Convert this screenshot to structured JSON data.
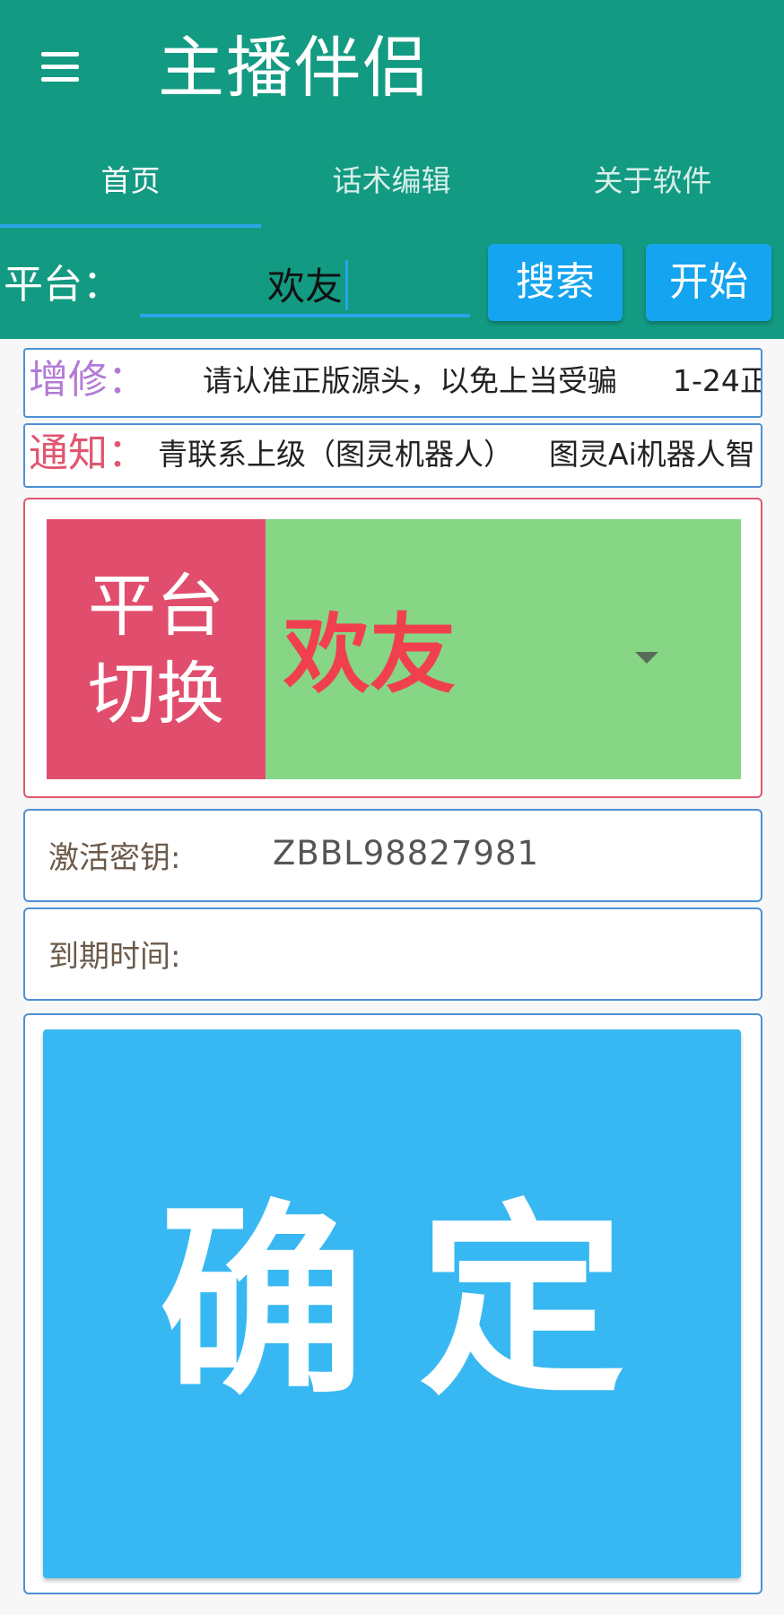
{
  "app": {
    "title": "主播伴侣"
  },
  "tabs": [
    {
      "label": "首页",
      "active": true
    },
    {
      "label": "话术编辑",
      "active": false
    },
    {
      "label": "关于软件",
      "active": false
    }
  ],
  "search": {
    "label": "平台：",
    "value": "欢友",
    "search_button": "搜索",
    "start_button": "开始"
  },
  "notices": {
    "update_label": "增修：",
    "update_text": "请认准正版源头，以免上当受骗",
    "update_text_2": "1-24正",
    "notify_label": "通知：",
    "notify_text": "青联系上级（图灵机器人）",
    "notify_text_2": "图灵Ai机器人智"
  },
  "platform_switch": {
    "label": "平台切换",
    "selected": "欢友"
  },
  "activation": {
    "key_label": "激活密钥:",
    "key_value": "ZBBL98827981",
    "expire_label": "到期时间:",
    "expire_value": ""
  },
  "confirm": {
    "label": "确定"
  },
  "colors": {
    "header": "#139a82",
    "accent_blue": "#15a4ef",
    "confirm_blue": "#38b8f2",
    "switch_red": "#e14e6d",
    "switch_green": "#87d686",
    "update_label_color": "#b37bd6",
    "notify_label_color": "#e0566f"
  },
  "icons": {
    "menu": "hamburger-menu-icon",
    "dropdown": "dropdown-caret-icon"
  }
}
